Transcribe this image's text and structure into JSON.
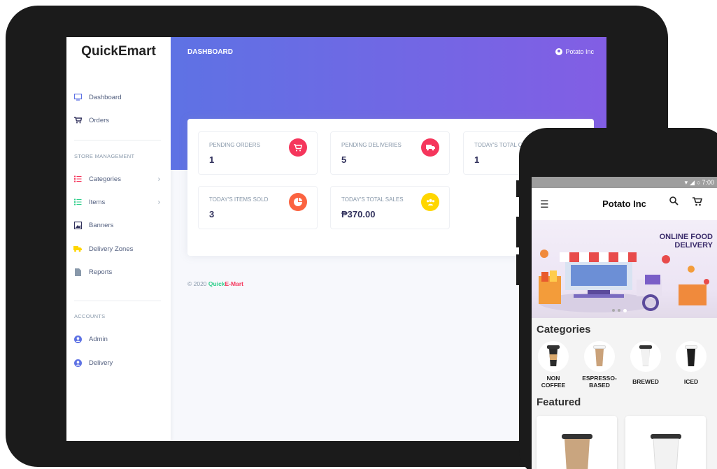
{
  "admin": {
    "brand": "QuickEmart",
    "nav": {
      "dashboard": "Dashboard",
      "orders": "Orders",
      "store_management_label": "STORE MANAGEMENT",
      "categories": "Categories",
      "items": "Items",
      "banners": "Banners",
      "delivery_zones": "Delivery Zones",
      "reports": "Reports",
      "accounts_label": "ACCOUNTS",
      "admin": "Admin",
      "delivery": "Delivery"
    },
    "header": {
      "title": "DASHBOARD",
      "user": "Potato Inc"
    },
    "stats": [
      {
        "label": "PENDING ORDERS",
        "value": "1",
        "icon": "cart-icon",
        "color": "#f5365c"
      },
      {
        "label": "PENDING DELIVERIES",
        "value": "5",
        "icon": "truck-icon",
        "color": "#f5365c"
      },
      {
        "label": "TODAY'S TOTAL O",
        "value": "1",
        "icon": "",
        "color": ""
      },
      {
        "label": "TODAY'S ITEMS SOLD",
        "value": "3",
        "icon": "pie-chart-icon",
        "color": "#fb6340"
      },
      {
        "label": "TODAY'S TOTAL SALES",
        "value": "₱370.00",
        "icon": "users-icon",
        "color": "#ffd600"
      }
    ],
    "footer": {
      "copyright": "© 2020",
      "brand_quick": "Quick",
      "brand_emart": "E-Mart"
    }
  },
  "mobile": {
    "status_time": "7:00",
    "app_title": "Potato Inc",
    "banner_text_line1": "ONLINE FOOD",
    "banner_text_line2": "DELIVERY",
    "categories_heading": "Categories",
    "categories": [
      {
        "name_line1": "NON",
        "name_line2": "COFFEE",
        "cup_color": "#2b2b2b"
      },
      {
        "name_line1": "ESPRESSO-",
        "name_line2": "BASED",
        "cup_color": "#caa27a"
      },
      {
        "name_line1": "BREWED",
        "name_line2": "",
        "cup_color": "#f2f2f2"
      },
      {
        "name_line1": "ICED",
        "name_line2": "",
        "cup_color": "#1e1e1e"
      }
    ],
    "featured_heading": "Featured"
  },
  "colors": {
    "hero_start": "#5e72e4",
    "hero_end": "#825ee4",
    "accent_green": "#2dce89",
    "accent_red": "#f5365c"
  }
}
